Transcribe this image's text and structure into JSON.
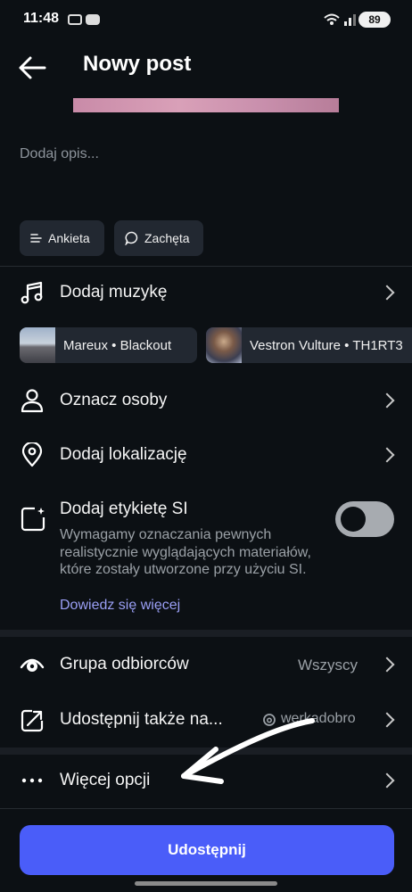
{
  "status": {
    "time": "11:48",
    "battery": "89"
  },
  "header": {
    "title": "Nowy post"
  },
  "caption": {
    "placeholder": "Dodaj opis..."
  },
  "chips": [
    {
      "label": "Ankieta"
    },
    {
      "label": "Zachęta"
    }
  ],
  "music": {
    "label": "Dodaj muzykę",
    "suggestions": [
      {
        "text": "Mareux • Blackout"
      },
      {
        "text": "Vestron Vulture • TH1RT3"
      }
    ]
  },
  "tag_people": {
    "label": "Oznacz osoby"
  },
  "location": {
    "label": "Dodaj lokalizację"
  },
  "ai_label": {
    "title": "Dodaj etykietę SI",
    "description": "Wymagamy oznaczania pewnych realistycznie wyglądających materiałów, które zostały utworzone przy użyciu SI.",
    "link": "Dowiedz się więcej",
    "toggle_on": false
  },
  "audience": {
    "label": "Grupa odbiorców",
    "value": "Wszyscy"
  },
  "share_also": {
    "label": "Udostępnij także na...",
    "value": "werkadobro"
  },
  "more_options": {
    "label": "Więcej opcji"
  },
  "share_button": {
    "label": "Udostępnij"
  },
  "colors": {
    "accent": "#4a5df9",
    "background": "#0c1014",
    "link": "#9a9ff5"
  }
}
